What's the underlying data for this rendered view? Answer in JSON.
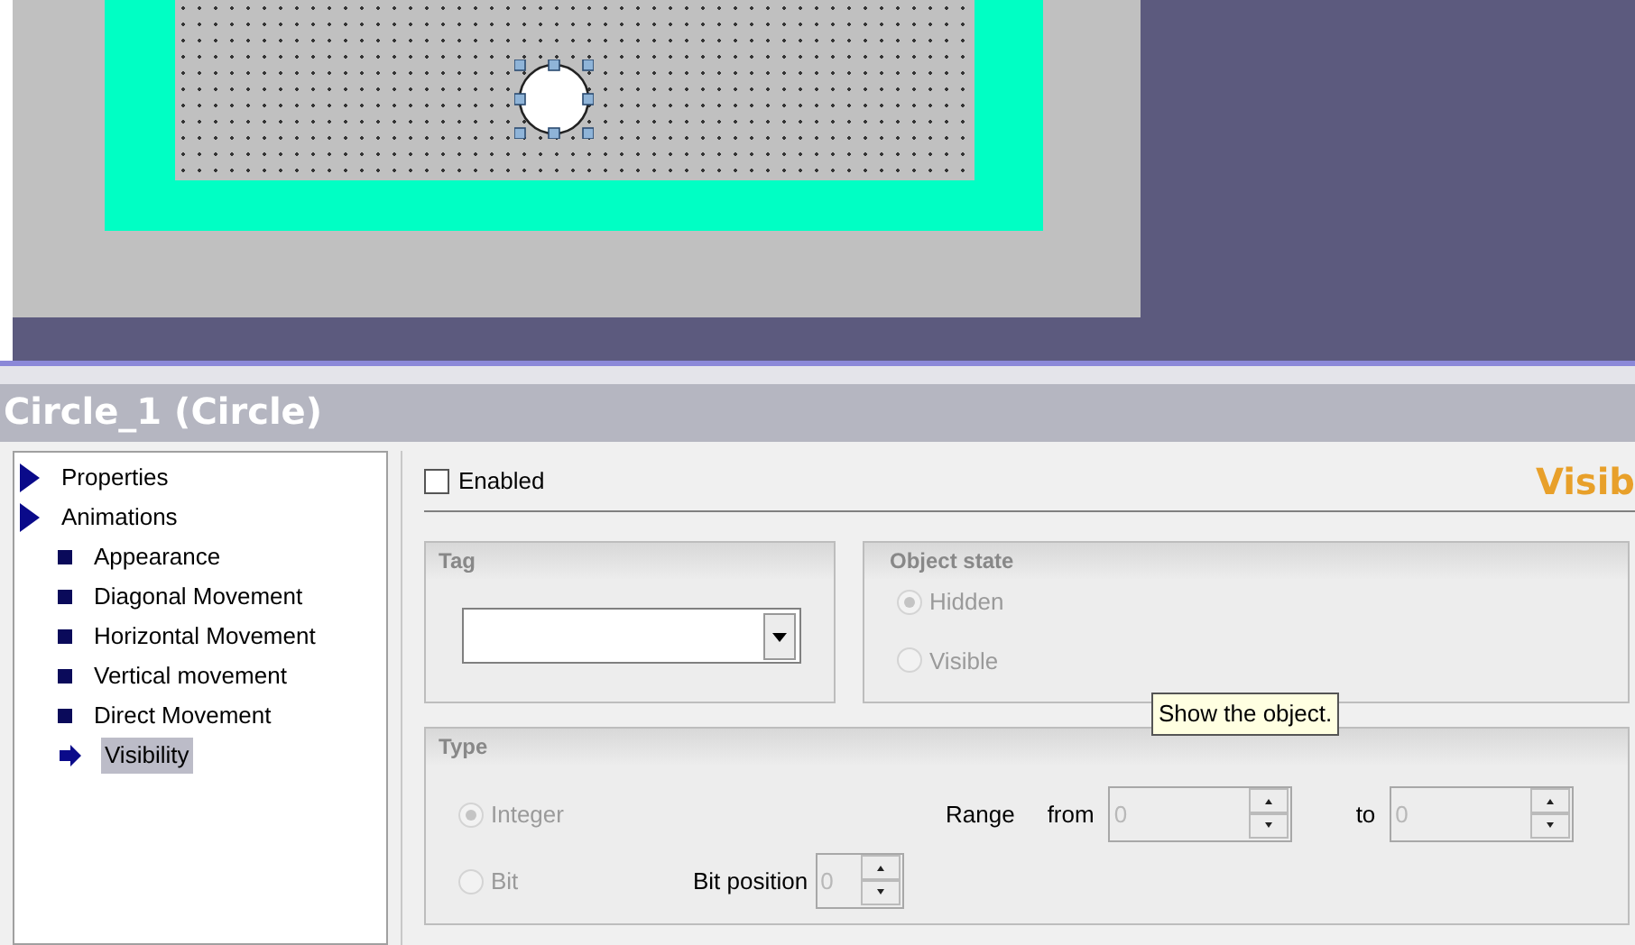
{
  "canvas": {
    "shape": {
      "kind": "circle",
      "selected": true
    }
  },
  "panel_title": "Circle_1 (Circle)",
  "tree": [
    {
      "label": "Properties",
      "selected": false
    },
    {
      "label": "Animations",
      "selected": false,
      "children": [
        {
          "label": "Appearance",
          "selected": false
        },
        {
          "label": "Diagonal Movement",
          "selected": false
        },
        {
          "label": "Horizontal Movement",
          "selected": false
        },
        {
          "label": "Vertical movement",
          "selected": false
        },
        {
          "label": "Direct Movement",
          "selected": false
        },
        {
          "label": "Visibility",
          "selected": true
        }
      ]
    }
  ],
  "enabled": {
    "label": "Enabled",
    "checked": false
  },
  "section_title": "Visib",
  "tag": {
    "title": "Tag"
  },
  "object_state": {
    "title": "Object state",
    "disabled": true,
    "options": [
      {
        "label": "Hidden",
        "selected": true
      },
      {
        "label": "Visible",
        "selected": false
      }
    ]
  },
  "tooltip": "Show the object.",
  "type": {
    "title": "Type",
    "disabled": true,
    "options": [
      {
        "label": "Integer",
        "selected": true
      },
      {
        "label": "Bit",
        "selected": false
      }
    ],
    "range_label": "Range",
    "from_label": "from",
    "from_value": "0",
    "to_label": "to",
    "to_value": "0",
    "bit_position_label": "Bit position",
    "bit_position_value": "0"
  }
}
